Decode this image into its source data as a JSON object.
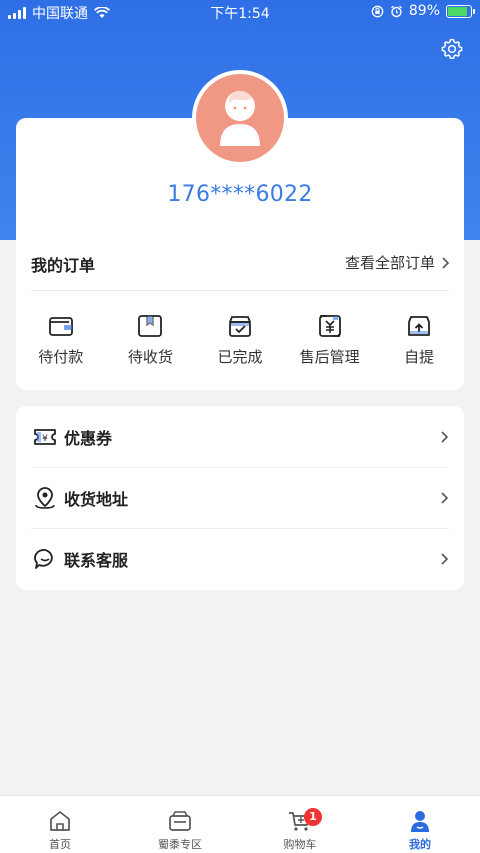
{
  "status_bar": {
    "carrier": "中国联通",
    "time": "下午1:54",
    "battery_percent": "89%"
  },
  "profile": {
    "phone": "176****6022"
  },
  "orders": {
    "title": "我的订单",
    "view_all": "查看全部订单",
    "items": [
      {
        "label": "待付款",
        "icon": "wallet-icon"
      },
      {
        "label": "待收货",
        "icon": "package-icon"
      },
      {
        "label": "已完成",
        "icon": "completed-box-icon"
      },
      {
        "label": "售后管理",
        "icon": "after-sales-icon"
      },
      {
        "label": "自提",
        "icon": "pickup-icon"
      }
    ]
  },
  "menu": {
    "items": [
      {
        "label": "优惠券",
        "icon": "coupon-icon"
      },
      {
        "label": "收货地址",
        "icon": "location-icon"
      },
      {
        "label": "联系客服",
        "icon": "chat-icon"
      }
    ]
  },
  "tabbar": {
    "tabs": [
      {
        "label": "首页",
        "icon": "home-icon"
      },
      {
        "label": "蜀黍专区",
        "icon": "zone-icon"
      },
      {
        "label": "购物车",
        "icon": "cart-icon",
        "badge": "1"
      },
      {
        "label": "我的",
        "icon": "profile-icon",
        "active": true
      }
    ]
  },
  "colors": {
    "primary": "#3c7be5",
    "header_bg": "#2f6fe6",
    "badge": "#e33333",
    "avatar": "#f09884"
  }
}
